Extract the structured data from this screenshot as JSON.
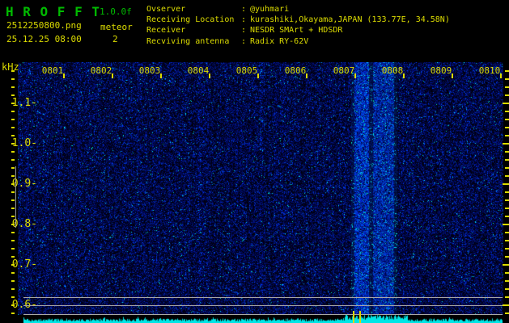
{
  "app": {
    "title": "H R O F F T",
    "version": "1.0.0f"
  },
  "capture": {
    "filename": "2512250800.png",
    "datetime": "25.12.25 08:00"
  },
  "meteor": {
    "label": "meteor",
    "count": "2"
  },
  "station": {
    "separator": ":",
    "rows": [
      {
        "label": "Ovserver",
        "value": "@yuhmari"
      },
      {
        "label": "Receiving Location",
        "value": "kurashiki,Okayama,JAPAN (133.77E, 34.58N)"
      },
      {
        "label": "Receiver",
        "value": "NESDR SMArt + HDSDR"
      },
      {
        "label": "Recviving antenna",
        "value": "Radix RY-62V"
      }
    ]
  },
  "spectrogram": {
    "freq_unit": "kHz",
    "freq_labels": [
      "1.1-",
      "1.0-",
      "0.9-",
      "0.8-",
      "0.7-",
      "0.6-"
    ],
    "freq_axis_range_khz": [
      0.58,
      1.22
    ],
    "time_labels": [
      "0801",
      "0802",
      "0803",
      "0804",
      "0805",
      "0806",
      "0807",
      "0808",
      "0809",
      "0810"
    ],
    "interference_bands_at_times": [
      "0807-0808"
    ],
    "meteor_marker_count": 2
  },
  "colors": {
    "green": "#00bb00",
    "yellow": "#dcdc00",
    "noise_blue": "#0000aa",
    "signal_cyan": "#00e6e6",
    "grid_gray": "#a8a8a8",
    "background": "#000000"
  }
}
